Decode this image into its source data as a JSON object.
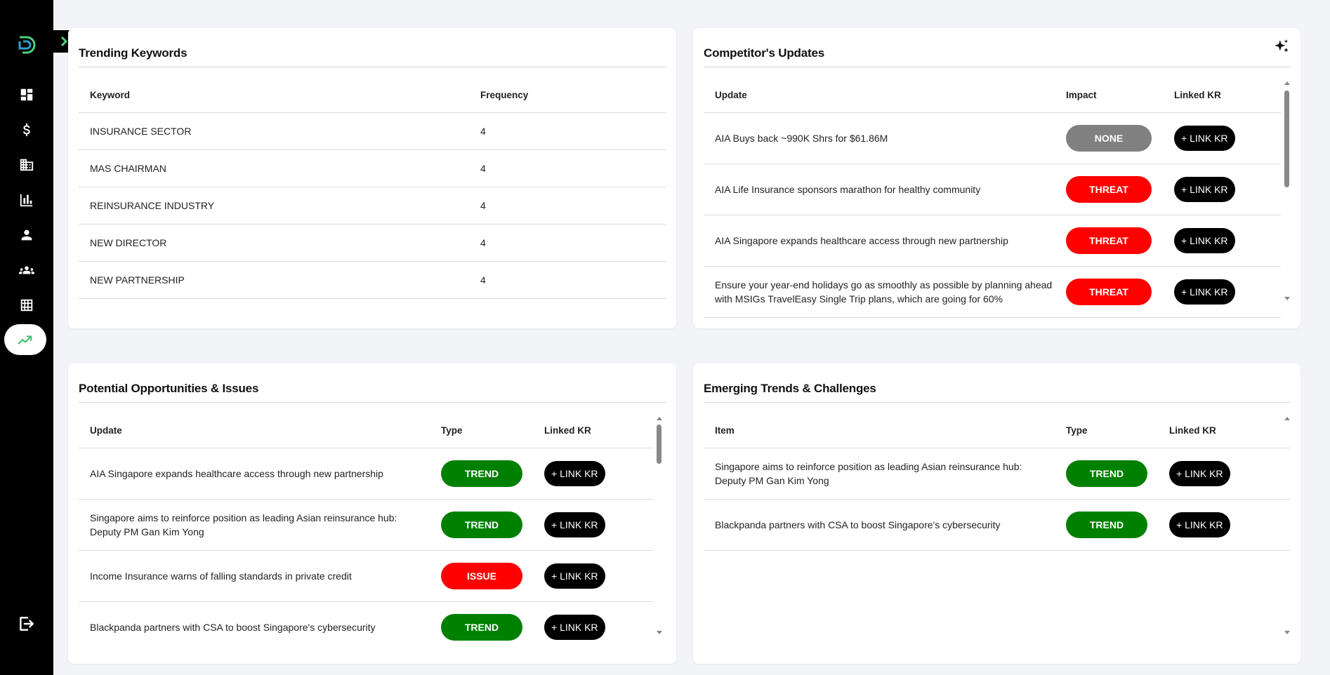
{
  "trending_keywords": {
    "title": "Trending Keywords",
    "columns": [
      "Keyword",
      "Frequency"
    ],
    "rows": [
      {
        "keyword": "INSURANCE SECTOR",
        "frequency": "4"
      },
      {
        "keyword": "MAS CHAIRMAN",
        "frequency": "4"
      },
      {
        "keyword": "REINSURANCE INDUSTRY",
        "frequency": "4"
      },
      {
        "keyword": "NEW DIRECTOR",
        "frequency": "4"
      },
      {
        "keyword": "NEW PARTNERSHIP",
        "frequency": "4"
      }
    ]
  },
  "competitor_updates": {
    "title": "Competitor's Updates",
    "columns": [
      "Update",
      "Impact",
      "Linked KR"
    ],
    "rows": [
      {
        "update": "AIA Buys back ~990K Shrs for $61.86M",
        "impact": "NONE",
        "link": "+ LINK KR"
      },
      {
        "update": "AIA Life Insurance sponsors marathon for healthy community",
        "impact": "THREAT",
        "link": "+ LINK KR"
      },
      {
        "update": "AIA Singapore expands healthcare access through new partnership",
        "impact": "THREAT",
        "link": "+ LINK KR"
      },
      {
        "update": "Ensure your year-end holidays go as smoothly as possible by planning ahead with MSIGs TravelEasy Single Trip plans, which are going for 60%",
        "impact": "THREAT",
        "link": "+ LINK KR"
      }
    ]
  },
  "opportunities": {
    "title": "Potential Opportunities & Issues",
    "columns": [
      "Update",
      "Type",
      "Linked KR"
    ],
    "rows": [
      {
        "update": "AIA Singapore expands healthcare access through new partnership",
        "type": "TREND",
        "link": "+ LINK KR"
      },
      {
        "update": "Singapore aims to reinforce position as leading Asian reinsurance hub: Deputy PM Gan Kim Yong",
        "type": "TREND",
        "link": "+ LINK KR"
      },
      {
        "update": "Income Insurance warns of falling standards in private credit",
        "type": "ISSUE",
        "link": "+ LINK KR"
      },
      {
        "update": "Blackpanda partners with CSA to boost Singapore's cybersecurity",
        "type": "TREND",
        "link": "+ LINK KR"
      }
    ]
  },
  "emerging_trends": {
    "title": "Emerging Trends & Challenges",
    "columns": [
      "Item",
      "Type",
      "Linked KR"
    ],
    "rows": [
      {
        "item": "Singapore aims to reinforce position as leading Asian reinsurance hub: Deputy PM Gan Kim Yong",
        "type": "TREND",
        "link": "+ LINK KR"
      },
      {
        "item": "Blackpanda partners with CSA to boost Singapore's cybersecurity",
        "type": "TREND",
        "link": "+ LINK KR"
      }
    ]
  },
  "sidebar": {
    "icons": [
      "dashboard-icon",
      "dollar-icon",
      "building-icon",
      "bar-chart-icon",
      "person-icon",
      "groups-icon",
      "grid-table-icon",
      "trending-icon"
    ],
    "active": "trending-icon"
  },
  "colors": {
    "sidebar": "#000000",
    "threat": "#ff0000",
    "trend": "#008000",
    "none": "#808080",
    "accent": "#4cd07d"
  }
}
